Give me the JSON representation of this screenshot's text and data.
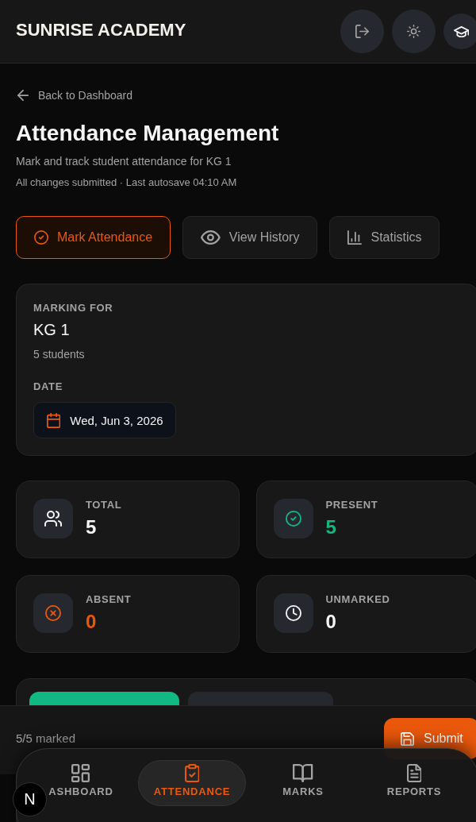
{
  "header": {
    "title": "SUNRISE ACADEMY",
    "actions": [
      {
        "kind": "logout"
      },
      {
        "kind": "theme"
      },
      {
        "kind": "profile"
      }
    ]
  },
  "back_link": {
    "label": "Back to Dashboard"
  },
  "page": {
    "title": "Attendance Management",
    "subtitle": "Mark and track student attendance for KG 1",
    "status": "All changes submitted · Last autosave 04:10 AM"
  },
  "tabs": [
    {
      "kind": "mark",
      "label": "Mark Attendance",
      "selected": true
    },
    {
      "kind": "history",
      "label": "View History",
      "selected": false
    },
    {
      "kind": "statistics",
      "label": "Statistics",
      "selected": false
    }
  ],
  "marking_card": {
    "label": "MARKING FOR",
    "class_name": "KG 1",
    "student_count": "5 students",
    "date_label": "DATE",
    "date": "Wed, Jun 3, 2026"
  },
  "stats": [
    {
      "kind": "total",
      "label": "TOTAL",
      "value": "5",
      "color": "#f5f5f5"
    },
    {
      "kind": "present",
      "label": "PRESENT",
      "value": "5",
      "color": "#10b981"
    },
    {
      "kind": "absent",
      "label": "ABSENT",
      "value": "0",
      "color": "#ea580c"
    },
    {
      "kind": "unmarked",
      "label": "UNMARKED",
      "value": "0",
      "color": "#f5f5f5"
    }
  ],
  "footer_bar": {
    "progress": "5/5 marked",
    "submit": "Submit"
  },
  "bottom_nav": [
    {
      "kind": "dashboard",
      "label": "ASHBOARD",
      "selected": false
    },
    {
      "kind": "attendance",
      "label": "ATTENDANCE",
      "selected": true
    },
    {
      "kind": "marks",
      "label": "MARKS",
      "selected": false
    },
    {
      "kind": "reports",
      "label": "REPORTS",
      "selected": false
    }
  ],
  "dev_badge": {
    "label": "N"
  }
}
